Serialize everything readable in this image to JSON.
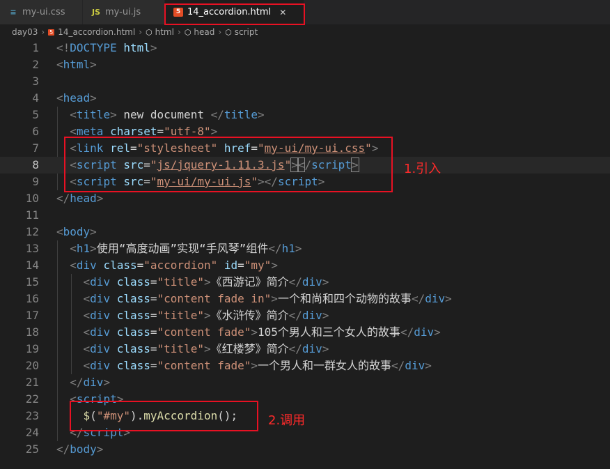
{
  "tabs": [
    {
      "label": "my-ui.css",
      "icon": "css-icon"
    },
    {
      "label": "my-ui.js",
      "icon": "js-icon"
    },
    {
      "label": "14_accordion.html",
      "icon": "html-icon",
      "active": true
    }
  ],
  "breadcrumb": [
    "day03",
    "14_accordion.html",
    "html",
    "head",
    "script"
  ],
  "lines": [
    {
      "n": "1"
    },
    {
      "n": "2"
    },
    {
      "n": "3"
    },
    {
      "n": "4"
    },
    {
      "n": "5"
    },
    {
      "n": "6"
    },
    {
      "n": "7"
    },
    {
      "n": "8"
    },
    {
      "n": "9"
    },
    {
      "n": "10"
    },
    {
      "n": "11"
    },
    {
      "n": "12"
    },
    {
      "n": "13"
    },
    {
      "n": "14"
    },
    {
      "n": "15"
    },
    {
      "n": "16"
    },
    {
      "n": "17"
    },
    {
      "n": "18"
    },
    {
      "n": "19"
    },
    {
      "n": "20"
    },
    {
      "n": "21"
    },
    {
      "n": "22"
    },
    {
      "n": "23"
    },
    {
      "n": "24"
    },
    {
      "n": "25"
    }
  ],
  "code": {
    "l1": "DOCTYPE",
    "l1b": "html",
    "l5": "new document",
    "l6_val": "\"utf-8\"",
    "l7_rel": "\"stylesheet\"",
    "l7_href": "my-ui/my-ui.css",
    "l8_src": "js/jquery-1.11.3.js",
    "l9_src": "my-ui/my-ui.js",
    "l13_text": "使用“高度动画”实现“手风琴”组件",
    "l14_class": "\"accordion\"",
    "l14_id": "\"my\"",
    "l15_text": "《西游记》简介",
    "l16_class": "\"content fade in\"",
    "l16_text": "一个和尚和四个动物的故事",
    "l17_text": "《水浒传》简介",
    "l18_class": "\"content fade\"",
    "l18_text": "105个男人和三个女人的故事",
    "l19_text": "《红楼梦》简介",
    "l20_class": "\"content fade\"",
    "l20_text": "一个男人和一群女人的故事",
    "l23_sel": "\"#my\"",
    "l23_fn": "myAccordion",
    "title_class": "\"title\""
  },
  "annotations": {
    "note1": "1.引入",
    "note2": "2.调用"
  },
  "colors": {
    "annotation": "#e81123",
    "tag": "#569cd6",
    "attr": "#9cdcfe",
    "string": "#ce9178"
  }
}
